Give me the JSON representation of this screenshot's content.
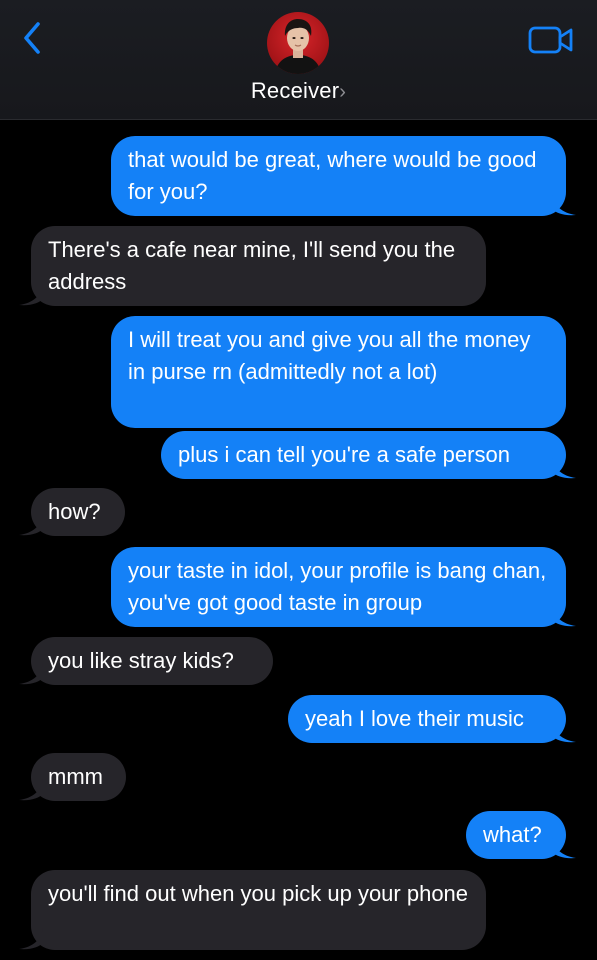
{
  "header": {
    "contact_name": "Receiver",
    "chevron": "›",
    "back_icon": "chevron-left-icon",
    "video_icon": "video-camera-icon",
    "accent_color": "#1481f7"
  },
  "messages": [
    {
      "from": "me",
      "text": "that would be great, where would be good for you?"
    },
    {
      "from": "them",
      "text": "There's a cafe near mine, I'll send you the address"
    },
    {
      "from": "me",
      "text": "I will treat you and give you all the money in purse rn (admittedly not a lot)"
    },
    {
      "from": "me",
      "text": "plus i can tell you're a safe person"
    },
    {
      "from": "them",
      "text": "how?"
    },
    {
      "from": "me",
      "text": "your taste in idol, your profile is bang chan, you've got good taste in group"
    },
    {
      "from": "them",
      "text": "you like stray kids?"
    },
    {
      "from": "me",
      "text": "yeah I love their music"
    },
    {
      "from": "them",
      "text": "mmm"
    },
    {
      "from": "me",
      "text": "what?"
    },
    {
      "from": "them",
      "text": "you'll find out when you pick up your phone"
    }
  ],
  "colors": {
    "sent_bubble": "#1481f7",
    "received_bubble": "#26252a",
    "background": "#000000"
  }
}
